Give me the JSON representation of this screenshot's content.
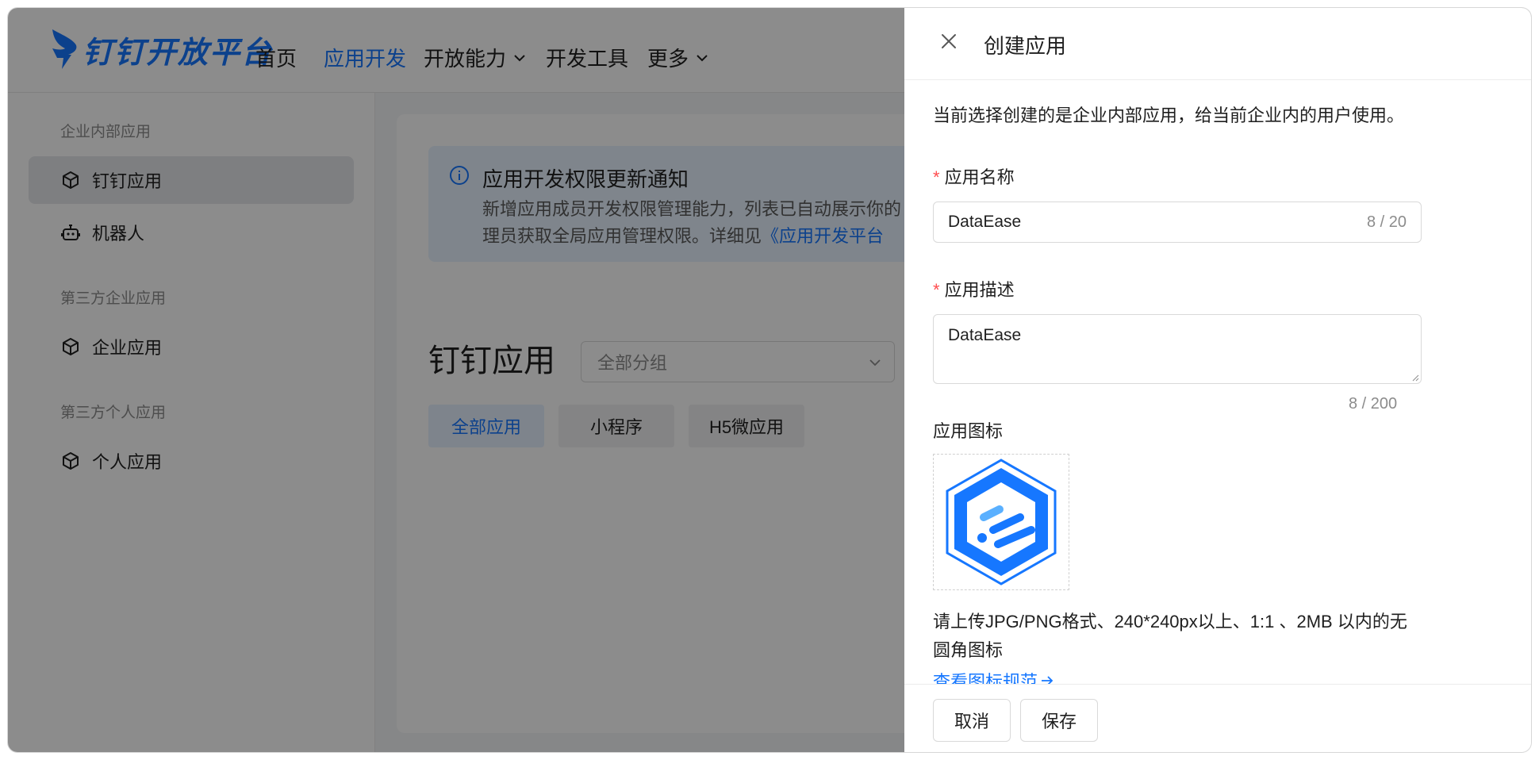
{
  "brand": {
    "name": "钉钉开放平台",
    "color": "#1677ff"
  },
  "nav": {
    "items": [
      {
        "label": "首页"
      },
      {
        "label": "应用开发",
        "active": true
      },
      {
        "label": "开放能力"
      },
      {
        "label": "开发工具"
      },
      {
        "label": "更多"
      }
    ]
  },
  "sidebar": {
    "groups": [
      {
        "label": "企业内部应用",
        "items": [
          {
            "label": "钉钉应用",
            "icon": "cube-icon",
            "active": true
          },
          {
            "label": "机器人",
            "icon": "robot-icon"
          }
        ]
      },
      {
        "label": "第三方企业应用",
        "items": [
          {
            "label": "企业应用",
            "icon": "cube-icon"
          }
        ]
      },
      {
        "label": "第三方个人应用",
        "items": [
          {
            "label": "个人应用",
            "icon": "cube-icon"
          }
        ]
      }
    ]
  },
  "notice": {
    "title": "应用开发权限更新通知",
    "line1": "新增应用成员开发权限管理能力，列表已自动展示你的",
    "line2_prefix": "理员获取全局应用管理权限。详细见",
    "line2_link": "《应用开发平台"
  },
  "main": {
    "title": "钉钉应用",
    "group_select_placeholder": "全部分组",
    "tabs": [
      {
        "label": "全部应用",
        "active": true
      },
      {
        "label": "小程序"
      },
      {
        "label": "H5微应用"
      }
    ]
  },
  "drawer": {
    "title": "创建应用",
    "intro": "当前选择创建的是企业内部应用，给当前企业内的用户使用。",
    "name_field": {
      "label": "应用名称",
      "required": "*",
      "value": "DataEase",
      "counter": "8 / 20"
    },
    "desc_field": {
      "label": "应用描述",
      "required": "*",
      "value": "DataEase",
      "counter": "8 / 200"
    },
    "icon_field": {
      "label": "应用图标"
    },
    "hint_line1": "请上传JPG/PNG格式、240*240px以上、1:1 、2MB 以内的无",
    "hint_line2": "圆角图标",
    "spec_link": "查看图标规范",
    "cancel_label": "取消",
    "save_label": "保存"
  }
}
